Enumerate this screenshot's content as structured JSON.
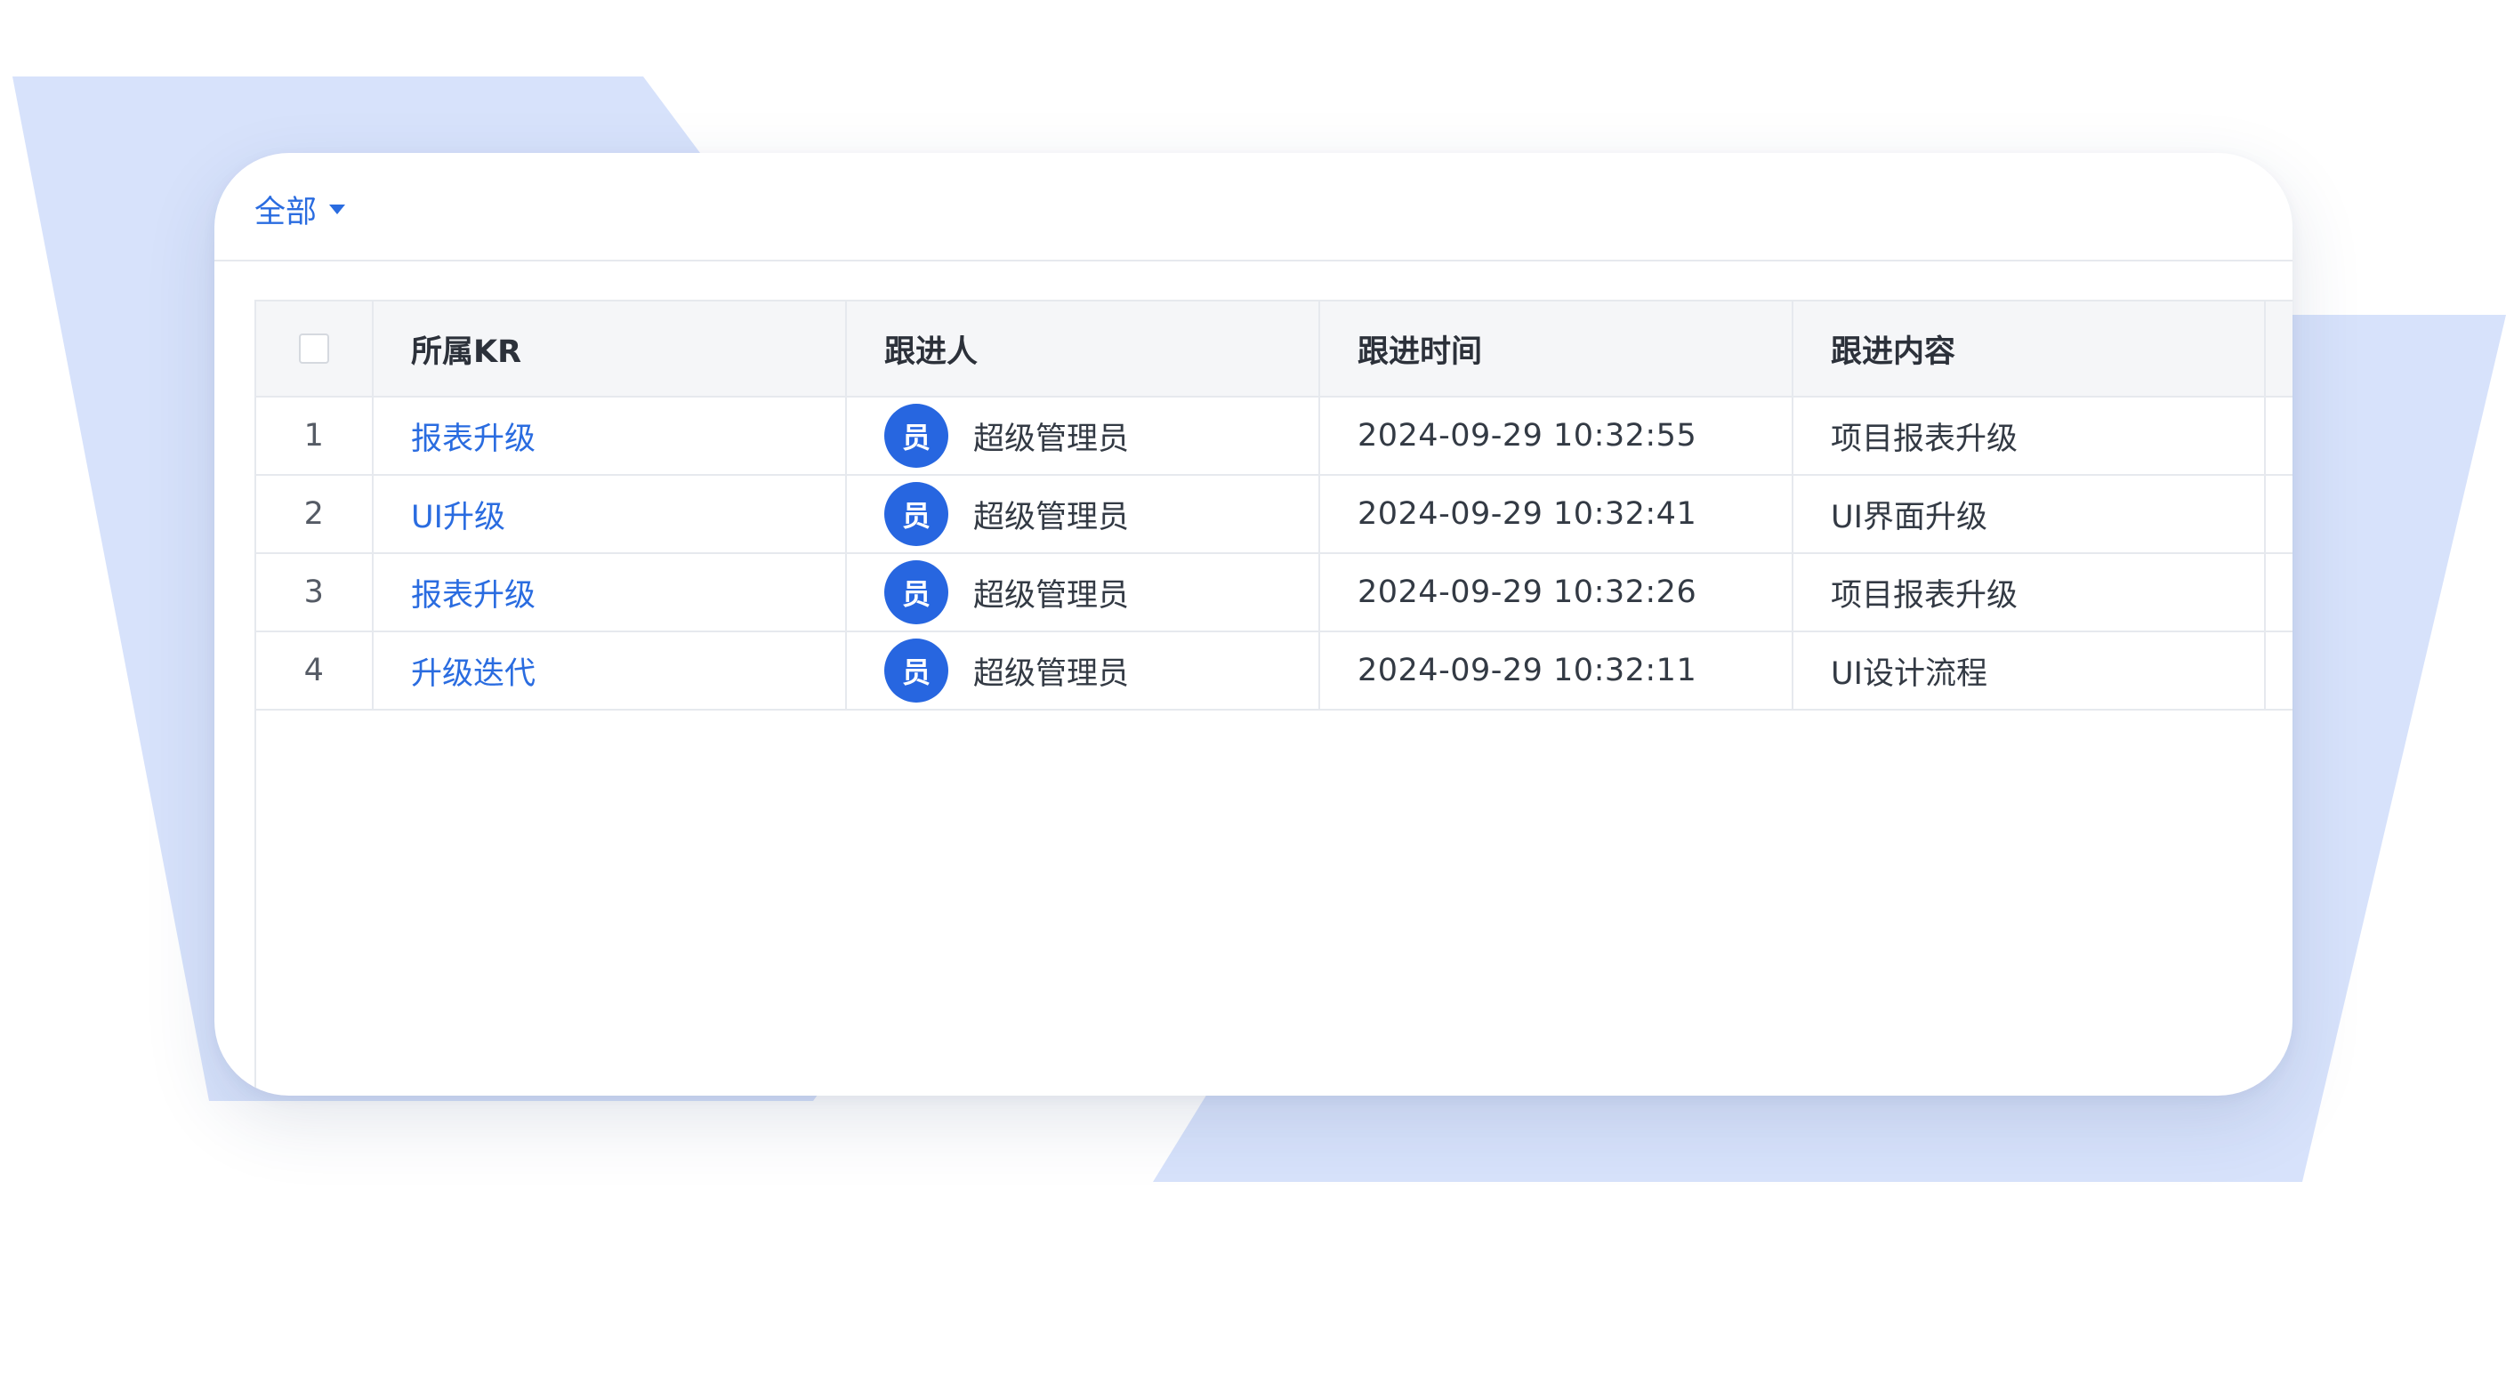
{
  "filter": {
    "label": "全部"
  },
  "table": {
    "columns": [
      "所属KR",
      "跟进人",
      "跟进时间",
      "跟进内容"
    ],
    "rows": [
      {
        "index": "1",
        "kr": "报表升级",
        "avatar": "员",
        "person": "超级管理员",
        "time": "2024-09-29 10:32:55",
        "content": "项目报表升级"
      },
      {
        "index": "2",
        "kr": "UI升级",
        "avatar": "员",
        "person": "超级管理员",
        "time": "2024-09-29 10:32:41",
        "content": "UI界面升级"
      },
      {
        "index": "3",
        "kr": "报表升级",
        "avatar": "员",
        "person": "超级管理员",
        "time": "2024-09-29 10:32:26",
        "content": "项目报表升级"
      },
      {
        "index": "4",
        "kr": "升级迭代",
        "avatar": "员",
        "person": "超级管理员",
        "time": "2024-09-29 10:32:11",
        "content": "UI设计流程"
      }
    ]
  },
  "colors": {
    "accent": "#2a6ce0",
    "avatar_bg": "#2766e0",
    "backdrop": "#d7e2fb"
  }
}
